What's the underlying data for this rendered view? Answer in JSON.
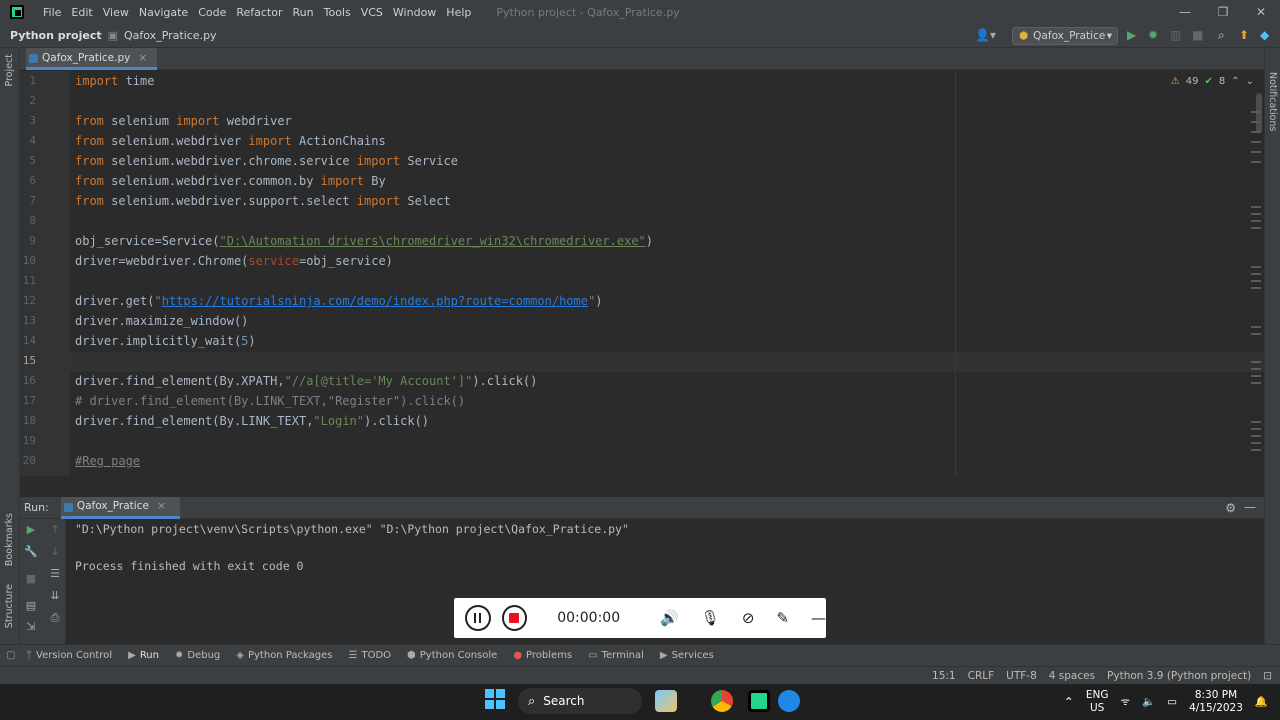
{
  "menu": [
    "File",
    "Edit",
    "View",
    "Navigate",
    "Code",
    "Refactor",
    "Run",
    "Tools",
    "VCS",
    "Window",
    "Help"
  ],
  "window_title": "Python project - Qafox_Pratice.py",
  "nav": {
    "project": "Python project",
    "file": "Qafox_Pratice.py",
    "run_config": "Qafox_Pratice"
  },
  "editor_tab": "Qafox_Pratice.py",
  "inspection": {
    "warnings": "49",
    "ok": "8"
  },
  "side": {
    "project": "Project",
    "bookmarks": "Bookmarks",
    "structure": "Structure",
    "notifications": "Notifications"
  },
  "line_numbers": [
    "1",
    "2",
    "3",
    "4",
    "5",
    "6",
    "7",
    "8",
    "9",
    "10",
    "11",
    "12",
    "13",
    "14",
    "15",
    "16",
    "17",
    "18",
    "19",
    "20"
  ],
  "code": {
    "l1": [
      "import",
      " time"
    ],
    "l3": [
      "from",
      " selenium ",
      "import",
      " webdriver"
    ],
    "l4": [
      "from",
      " selenium.webdriver ",
      "import",
      " ActionChains"
    ],
    "l5": [
      "from",
      " selenium.webdriver.chrome.service ",
      "import",
      " Service"
    ],
    "l6": [
      "from",
      " selenium.webdriver.common.by ",
      "import",
      " By"
    ],
    "l7": [
      "from",
      " selenium.webdriver.support.select ",
      "import",
      " Select"
    ],
    "l9": [
      "obj_service=Service(",
      "\"D:\\Automation drivers\\chromedriver_win32\\chromedriver.exe\"",
      ")"
    ],
    "l10": [
      "driver=webdriver.Chrome(",
      "service",
      "=obj_service)"
    ],
    "l12": [
      "driver.get(",
      "\"",
      "https://tutorialsninja.com/demo/index.php?route=common/home",
      "\"",
      ")"
    ],
    "l13": "driver.maximize_window()",
    "l14": [
      "driver.implicitly_wait(",
      "5",
      ")"
    ],
    "l16": [
      "driver.find_element(By.XPATH,",
      "\"//a[@title='My Account']\"",
      ").click()"
    ],
    "l17": "# driver.find_element(By.LINK_TEXT,\"Register\").click()",
    "l18": [
      "driver.find_element(By.LINK_TEXT,",
      "\"Login\"",
      ").click()"
    ],
    "l20": "#Reg page"
  },
  "run": {
    "label": "Run:",
    "tab": "Qafox_Pratice",
    "console": [
      "\"D:\\Python project\\venv\\Scripts\\python.exe\" \"D:\\Python project\\Qafox_Pratice.py\"",
      "Process finished with exit code 0"
    ]
  },
  "recorder": {
    "timer": "00:00:00"
  },
  "bottom_tools": [
    "Version Control",
    "Run",
    "Debug",
    "Python Packages",
    "TODO",
    "Python Console",
    "Problems",
    "Terminal",
    "Services"
  ],
  "status": [
    "15:1",
    "CRLF",
    "UTF-8",
    "4 spaces",
    "Python 3.9 (Python project)"
  ],
  "taskbar": {
    "search": "Search",
    "lang1": "ENG",
    "lang2": "US",
    "time": "8:30 PM",
    "date": "4/15/2023"
  },
  "colors": {
    "accent": "#4a88c7",
    "keyword": "#cc7832",
    "string": "#6a8759",
    "link": "#287bde"
  }
}
